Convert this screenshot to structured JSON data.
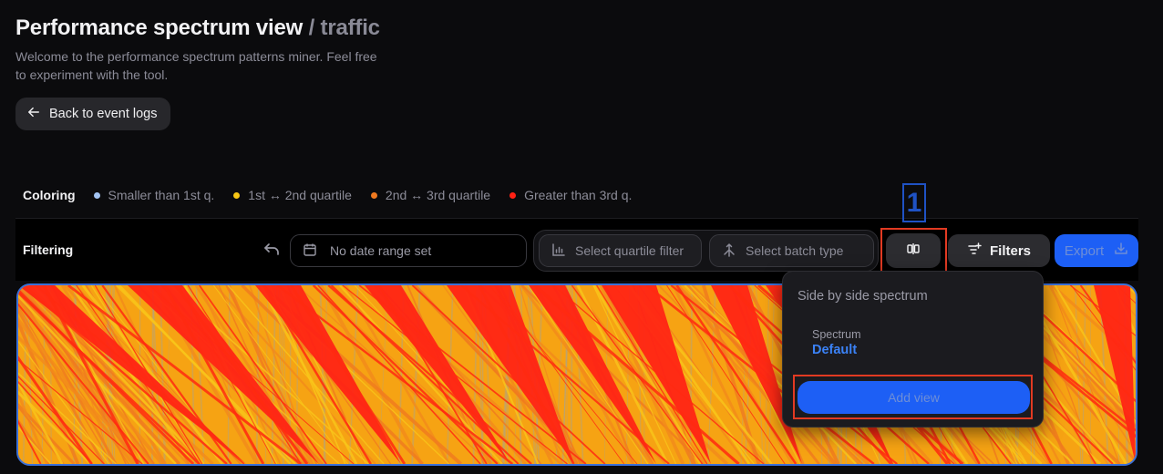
{
  "header": {
    "title": "Performance spectrum view",
    "subtitle": "/ traffic",
    "description": "Welcome to the performance spectrum patterns miner. Feel free to experiment with the tool.",
    "back_label": "Back to event logs"
  },
  "coloring": {
    "label": "Coloring",
    "legend": [
      {
        "label": "Smaller than 1st q.",
        "color": "#a3c4f3"
      },
      {
        "label": "1st ↔ 2nd quartile",
        "color": "#f7c614"
      },
      {
        "label": "2nd ↔ 3rd quartile",
        "color": "#f0791f"
      },
      {
        "label": "Greater than 3rd q.",
        "color": "#ff2114"
      }
    ]
  },
  "filtering": {
    "label": "Filtering",
    "date_placeholder": "No date range set",
    "quartile_placeholder": "Select quartile filter",
    "batch_placeholder": "Select batch type",
    "filters_label": "Filters",
    "export_label": "Export"
  },
  "annotation": {
    "marker": "1"
  },
  "popover": {
    "title": "Side by side spectrum",
    "spectrum_label": "Spectrum",
    "spectrum_value": "Default",
    "add_view_label": "Add view"
  },
  "icons": {
    "back": "arrow-left-icon",
    "undo": "undo-icon",
    "calendar": "calendar-icon",
    "chart": "bar-chart-icon",
    "merge": "merge-icon",
    "side_by_side": "columns-icon",
    "filters": "filter-lines-plus-icon",
    "export": "download-icon"
  }
}
